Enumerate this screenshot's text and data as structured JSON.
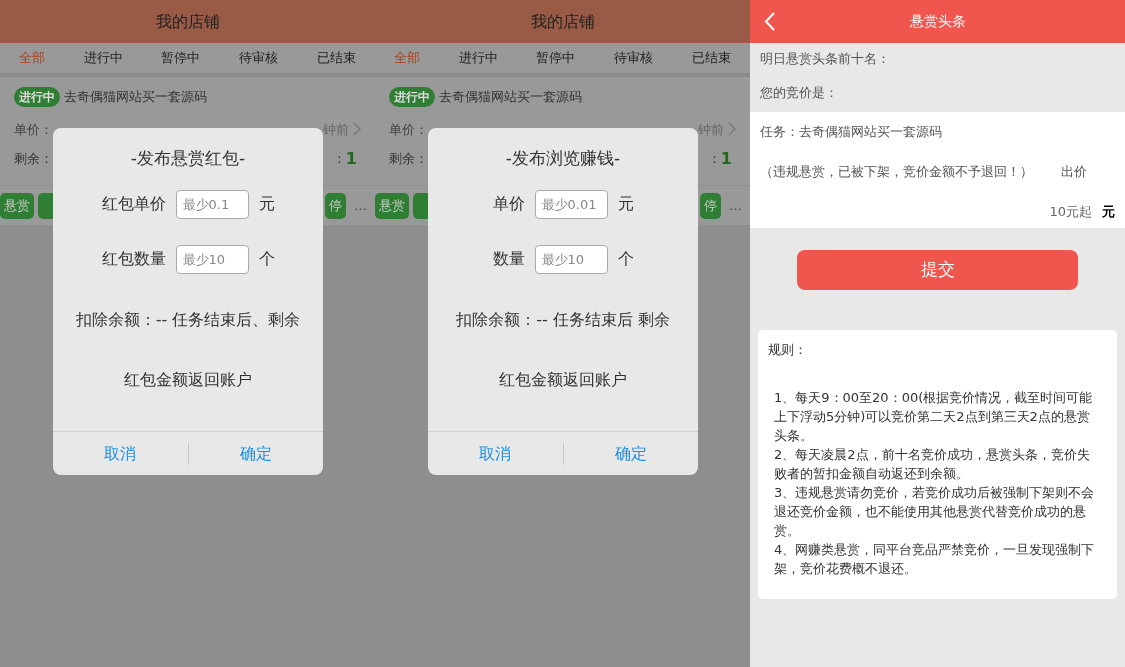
{
  "screens": [
    {
      "title": "我的店铺",
      "tabs": [
        {
          "label": "全部",
          "selected": true
        },
        {
          "label": "进行中",
          "selected": false
        },
        {
          "label": "暂停中",
          "selected": false
        },
        {
          "label": "待审核",
          "selected": false
        },
        {
          "label": "已结束",
          "selected": false
        }
      ],
      "task": {
        "status": "进行中",
        "title": "去奇偶猫网站买一套源码",
        "price_label": "单价：",
        "time": "钟前",
        "remain_label": "剩余：",
        "locked_label": "：",
        "locked_value": "1",
        "buttons": [
          {
            "kind": "labeled",
            "label": "悬赏"
          },
          {
            "kind": "covered"
          },
          {
            "kind": "labeled",
            "label": "停"
          }
        ],
        "more": "…"
      },
      "dialog": {
        "title": "-发布悬赏红包-",
        "fields": [
          {
            "label": "红包单价",
            "placeholder": "最少0.1",
            "unit": "元"
          },
          {
            "label": "红包数量",
            "placeholder": "最少10",
            "unit": "个"
          }
        ],
        "deduct": "扣除余额：-- 任务结束后、剩余",
        "note": "红包金额返回账户",
        "cancel": "取消",
        "confirm": "确定"
      }
    },
    {
      "title": "我的店铺",
      "tabs": [
        {
          "label": "全部",
          "selected": true
        },
        {
          "label": "进行中",
          "selected": false
        },
        {
          "label": "暂停中",
          "selected": false
        },
        {
          "label": "待审核",
          "selected": false
        },
        {
          "label": "已结束",
          "selected": false
        }
      ],
      "task": {
        "status": "进行中",
        "title": "去奇偶猫网站买一套源码",
        "price_label": "单价：",
        "time": "钟前",
        "remain_label": "剩余：",
        "locked_label": "：",
        "locked_value": "1",
        "buttons": [
          {
            "kind": "labeled",
            "label": "悬赏"
          },
          {
            "kind": "covered"
          },
          {
            "kind": "labeled",
            "label": "停"
          }
        ],
        "more": "…"
      },
      "dialog": {
        "title": "-发布浏览赚钱-",
        "fields": [
          {
            "label": "单价",
            "placeholder": "最少0.01",
            "unit": "元"
          },
          {
            "label": "数量",
            "placeholder": "最少10",
            "unit": "个"
          }
        ],
        "deduct": "扣除余额：-- 任务结束后 剩余",
        "note": "红包金额返回账户",
        "cancel": "取消",
        "confirm": "确定"
      }
    }
  ],
  "bid_page": {
    "title": "悬赏头条",
    "top_ten": "明日悬赏头条前十名：",
    "your_bid": "您的竞价是：",
    "task": "任务：去奇偶猫网站买一套源码",
    "warning": "（违规悬赏，已被下架，竞价金额不予退回！）",
    "bid_label": "出价",
    "bid_placeholder": "10元起",
    "bid_unit": "元",
    "submit": "提交",
    "rules_title": "规则：",
    "rules": [
      "1、每天9：00至20：00(根据竞价情况，截至时间可能上下浮动5分钟)可以竞价第二天2点到第三天2点的悬赏头条。",
      "2、每天凌晨2点，前十名竞价成功，悬赏头条，竞价失败者的暂扣金额自动返还到余额。",
      "3、违规悬赏请勿竞价，若竞价成功后被强制下架则不会退还竞价金额，也不能使用其他悬赏代替竞价成功的悬赏。",
      "4、网赚类悬赏，同平台竞品严禁竞价，一旦发现强制下架，竞价花费概不退还。"
    ]
  }
}
